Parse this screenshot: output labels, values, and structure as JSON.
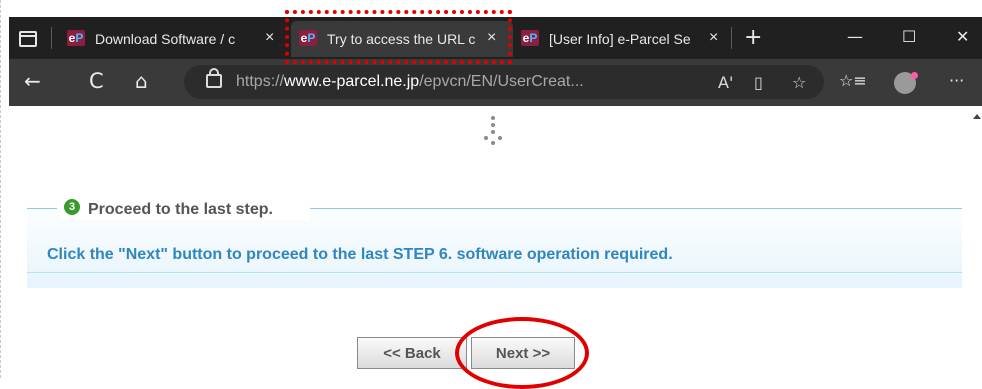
{
  "tabs": [
    {
      "title": "Download Software / c",
      "favicon": "eP",
      "active": false
    },
    {
      "title": "Try to access the URL c",
      "favicon": "eP",
      "active": true
    },
    {
      "title": "[User Info] e-Parcel Se",
      "favicon": "eP",
      "active": false
    }
  ],
  "tab_close_glyph": "×",
  "new_tab_glyph": "+",
  "window_controls": {
    "minimize": "—",
    "maximize": "☐",
    "close": "✕"
  },
  "nav": {
    "back": "←",
    "refresh": "C",
    "home": "⌂",
    "more": "···"
  },
  "address": {
    "scheme": "https://",
    "host": "www.e-parcel.ne.jp",
    "path": "/epvcn/EN/UserCreat..."
  },
  "address_icons": {
    "read_aloud": "A'",
    "immersive": "▯",
    "favorite_add": "☆",
    "favorites": "☆≡",
    "collections": "⧉"
  },
  "page": {
    "step_icon_text": "3",
    "section_title": "Proceed to the last step.",
    "message": "Click the \"Next\" button to proceed to the last STEP 6. software operation required.",
    "back_button": "<< Back",
    "next_button": "Next >>"
  },
  "colors": {
    "highlight": "#e00000",
    "message": "#2f86c0",
    "tab_bg": "#202020",
    "toolbar_bg": "#3a3a3a"
  }
}
